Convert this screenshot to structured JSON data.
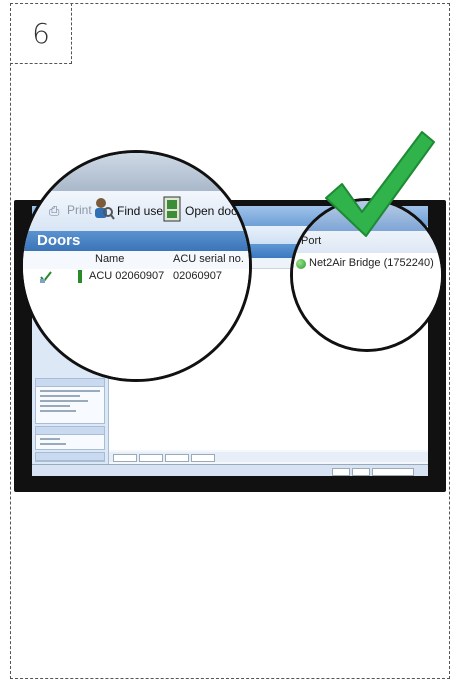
{
  "step": {
    "number": "6"
  },
  "toolbar": {
    "print_label": "Print",
    "find_user_label": "Find user",
    "open_door_label": "Open door"
  },
  "section": {
    "title": "Doors"
  },
  "table": {
    "columns": {
      "name": "Name",
      "acu_serial": "ACU serial no.",
      "port": "Port"
    },
    "rows": [
      {
        "name": "ACU 02060907",
        "acu_serial": "02060907",
        "port": "Net2Air Bridge (1752240)"
      }
    ]
  },
  "colors": {
    "accent_blue": "#3b74b8",
    "check_green": "#2fb34a",
    "status_green": "#2a9a2a"
  },
  "icons": [
    "step-number",
    "print-icon",
    "find-user-icon",
    "open-door-icon",
    "door-status-icon",
    "port-status-icon",
    "checkmark-icon"
  ]
}
